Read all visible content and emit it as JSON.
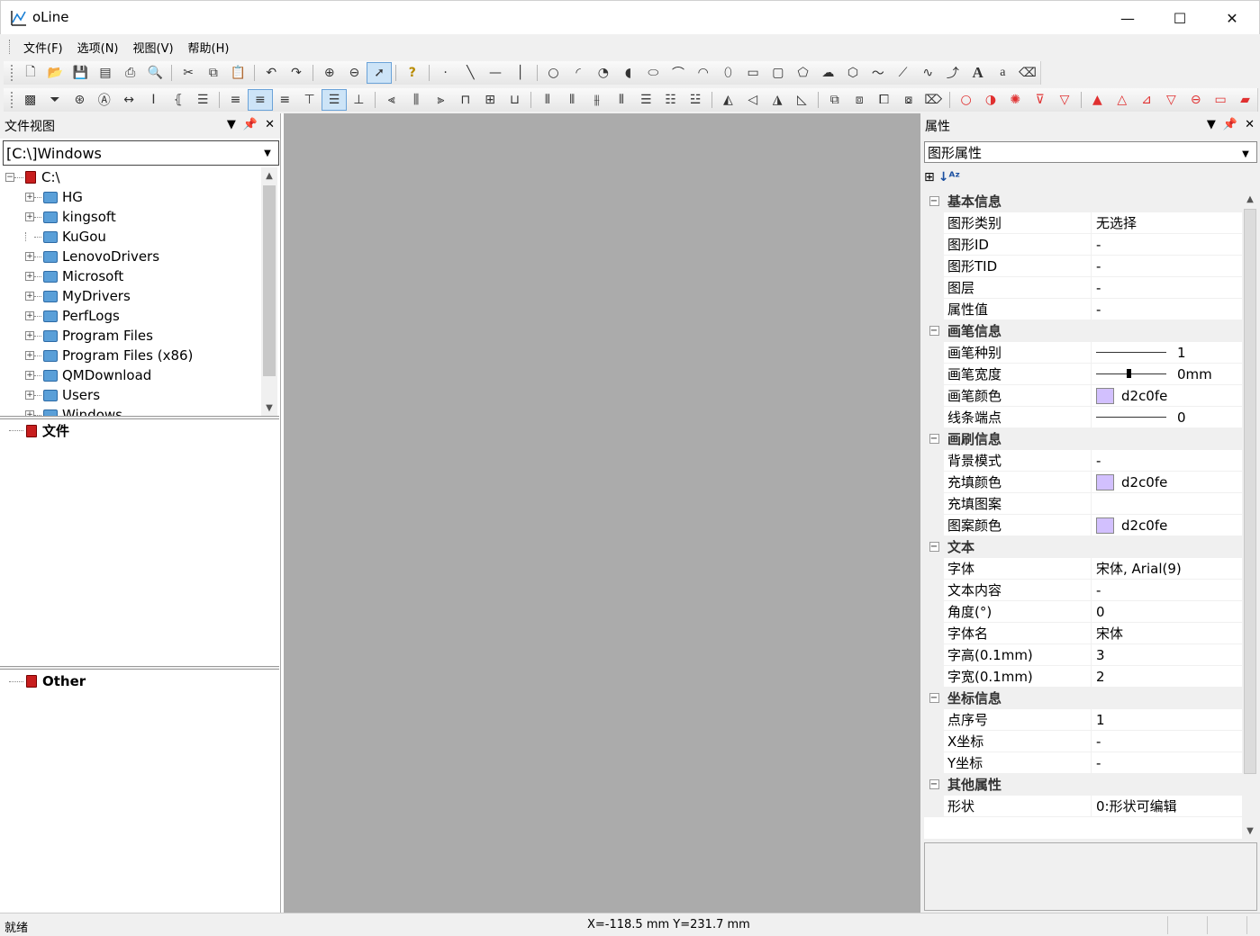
{
  "window": {
    "title": "oLine",
    "min": "—",
    "max": "☐",
    "close": "✕"
  },
  "menu": [
    "文件(F)",
    "选项(N)",
    "视图(V)",
    "帮助(H)"
  ],
  "left_panel": {
    "title": "文件视图",
    "path": "[C:\\]Windows",
    "tree": {
      "root": "C:\\",
      "items": [
        "HG",
        "kingsoft",
        "KuGou",
        "LenovoDrivers",
        "Microsoft",
        "MyDrivers",
        "PerfLogs",
        "Program Files",
        "Program Files (x86)",
        "QMDownload",
        "Users",
        "Windows"
      ]
    },
    "section_files": "文件",
    "section_other": "Other"
  },
  "right_panel": {
    "title": "属性",
    "selector": "图形属性",
    "categories": [
      {
        "name": "基本信息",
        "rows": [
          {
            "label": "图形类别",
            "value": "无选择"
          },
          {
            "label": "图形ID",
            "value": "-"
          },
          {
            "label": "图形TID",
            "value": "-"
          },
          {
            "label": "图层",
            "value": "-"
          },
          {
            "label": "属性值",
            "value": "-"
          }
        ]
      },
      {
        "name": "画笔信息",
        "rows": [
          {
            "label": "画笔种别",
            "value": "1",
            "kind": "line"
          },
          {
            "label": "画笔宽度",
            "value": "0mm",
            "kind": "knob"
          },
          {
            "label": "画笔颜色",
            "value": "d2c0fe",
            "kind": "color"
          },
          {
            "label": "线条端点",
            "value": "0",
            "kind": "line"
          }
        ]
      },
      {
        "name": "画刷信息",
        "rows": [
          {
            "label": "背景模式",
            "value": "-"
          },
          {
            "label": "充填颜色",
            "value": "d2c0fe",
            "kind": "color"
          },
          {
            "label": "充填图案",
            "value": ""
          },
          {
            "label": "图案颜色",
            "value": "d2c0fe",
            "kind": "color"
          }
        ]
      },
      {
        "name": "文本",
        "rows": [
          {
            "label": "字体",
            "value": "宋体, Arial(9)"
          },
          {
            "label": "文本内容",
            "value": "-"
          },
          {
            "label": "角度(°)",
            "value": "0"
          },
          {
            "label": "字体名",
            "value": "宋体"
          },
          {
            "label": "字高(0.1mm)",
            "value": "3"
          },
          {
            "label": "字宽(0.1mm)",
            "value": "2"
          }
        ]
      },
      {
        "name": "坐标信息",
        "rows": [
          {
            "label": "点序号",
            "value": "1"
          },
          {
            "label": "X坐标",
            "value": "-"
          },
          {
            "label": "Y坐标",
            "value": "-"
          }
        ]
      },
      {
        "name": "其他属性",
        "rows": [
          {
            "label": "形状",
            "value": "0:形状可编辑"
          }
        ]
      }
    ]
  },
  "status": {
    "left": "就绪",
    "coords": "X=-118.5 mm  Y=231.7 mm"
  },
  "colors": {
    "swatch": "#d2c0fe",
    "canvas": "#ababab",
    "accent_red": "#e03030"
  }
}
